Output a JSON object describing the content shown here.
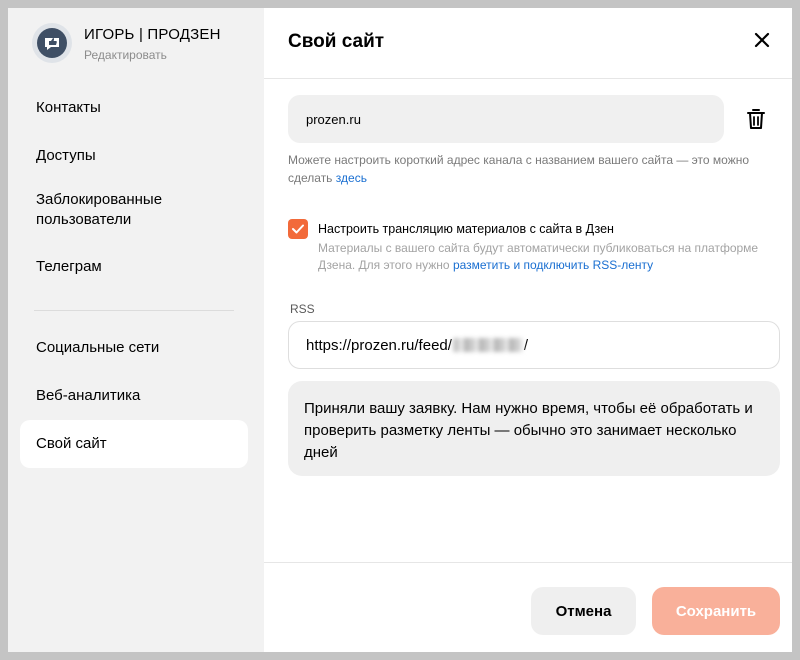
{
  "profile": {
    "name": "ИГОРЬ | ПРОДЗЕН",
    "edit_label": "Редактировать",
    "avatar_icon": "thumbs-up-chat-icon"
  },
  "sidebar": {
    "group1": [
      {
        "label": "Контакты"
      },
      {
        "label": "Доступы"
      },
      {
        "label": "Заблокированные пользователи"
      },
      {
        "label": "Телеграм"
      }
    ],
    "group2": [
      {
        "label": "Социальные сети"
      },
      {
        "label": "Веб-аналитика"
      },
      {
        "label": "Свой сайт",
        "active": true
      }
    ]
  },
  "main": {
    "title": "Свой сайт",
    "close_icon": "close-icon",
    "site": {
      "value": "prozen.ru",
      "delete_icon": "trash-icon"
    },
    "hint": {
      "text": "Можете настроить короткий адрес канала с названием вашего сайта — это можно сделать ",
      "link": "здесь"
    },
    "broadcast": {
      "checked": true,
      "label": "Настроить трансляцию материалов с сайта в Дзен",
      "description": "Материалы с вашего сайта будут автоматически публиковаться на платформе Дзена. Для этого нужно ",
      "link": "разметить и подключить RSS-ленту"
    },
    "rss": {
      "label": "RSS",
      "value_prefix": "https://prozen.ru/feed/",
      "value_suffix": "/"
    },
    "notice": "Приняли вашу заявку. Нам нужно время, чтобы её обработать и проверить разметку ленты — обычно это занимает несколько дней"
  },
  "footer": {
    "cancel_label": "Отмена",
    "save_label": "Сохранить"
  },
  "colors": {
    "accent": "#f26a3a",
    "accent_disabled": "#f9b09a",
    "link": "#1a6fd1"
  }
}
